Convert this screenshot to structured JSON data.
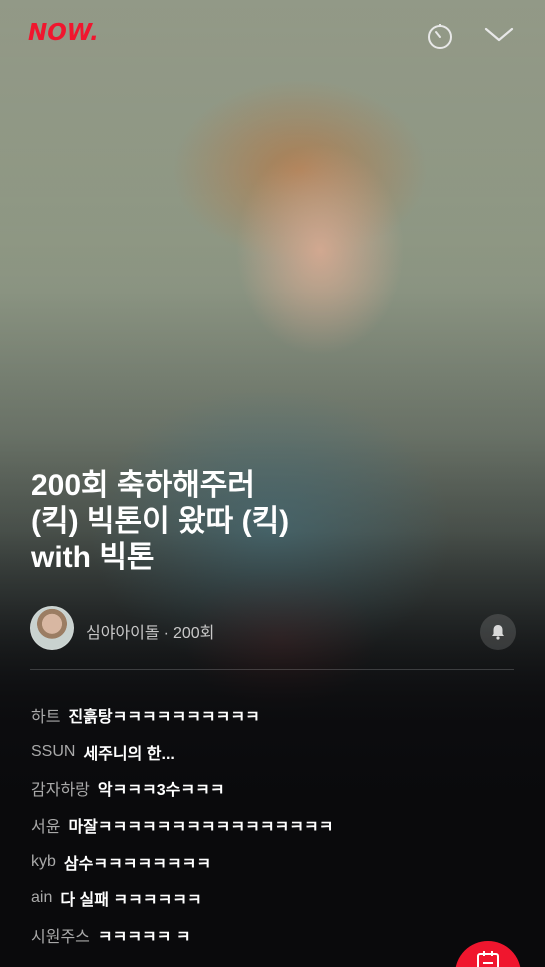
{
  "app": {
    "logo": "NOW."
  },
  "header": {
    "timer_icon": "timer-icon",
    "collapse_icon": "chevron-down-icon"
  },
  "show": {
    "title_lines": [
      "200회 축하해주러",
      "(킥) 빅톤이 왔따 (킥)",
      "with 빅톤"
    ]
  },
  "channel": {
    "name": "심야아이돌",
    "separator": "·",
    "episode": "200회",
    "bell_icon": "bell-icon"
  },
  "chat": [
    {
      "user": "하트",
      "message": "진흙탕ㅋㅋㅋㅋㅋㅋㅋㅋㅋㅋ"
    },
    {
      "user": "SSUN",
      "message": "세주니의 한..."
    },
    {
      "user": "감자하랑",
      "message": "악ㅋㅋㅋ3수ㅋㅋㅋ"
    },
    {
      "user": "서윤",
      "message": "마잘ㅋㅋㅋㅋㅋㅋㅋㅋㅋㅋㅋㅋㅋㅋㅋㅋ"
    },
    {
      "user": "kyb",
      "message": "삼수ㅋㅋㅋㅋㅋㅋㅋㅋ"
    },
    {
      "user": "ain",
      "message": "다 실패 ㅋㅋㅋㅋㅋㅋ"
    },
    {
      "user": "시원주스",
      "message": "ㅋㅋㅋㅋㅋ ㅋ"
    }
  ],
  "colors": {
    "brand": "#f0162e",
    "background": "#0d0d0f",
    "chat_user": "#a9a9a9"
  }
}
